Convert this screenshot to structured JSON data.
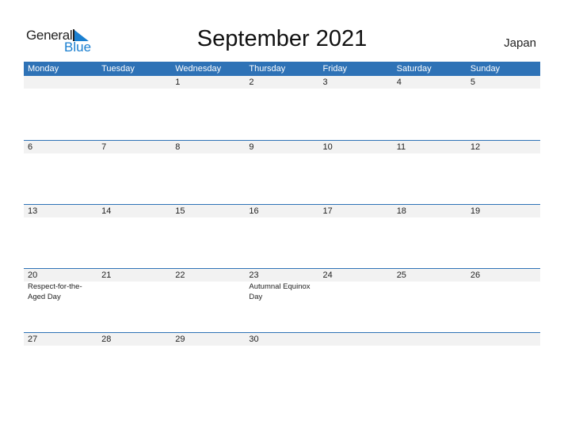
{
  "brand": {
    "word1": "General",
    "word2": "Blue",
    "color": "#1a7fd0"
  },
  "title": "September 2021",
  "country": "Japan",
  "header_color": "#2e72b6",
  "weekdays": [
    "Monday",
    "Tuesday",
    "Wednesday",
    "Thursday",
    "Friday",
    "Saturday",
    "Sunday"
  ],
  "weeks": [
    {
      "days": [
        {
          "d": "",
          "h": ""
        },
        {
          "d": "",
          "h": ""
        },
        {
          "d": "1",
          "h": ""
        },
        {
          "d": "2",
          "h": ""
        },
        {
          "d": "3",
          "h": ""
        },
        {
          "d": "4",
          "h": ""
        },
        {
          "d": "5",
          "h": ""
        }
      ]
    },
    {
      "days": [
        {
          "d": "6",
          "h": ""
        },
        {
          "d": "7",
          "h": ""
        },
        {
          "d": "8",
          "h": ""
        },
        {
          "d": "9",
          "h": ""
        },
        {
          "d": "10",
          "h": ""
        },
        {
          "d": "11",
          "h": ""
        },
        {
          "d": "12",
          "h": ""
        }
      ]
    },
    {
      "days": [
        {
          "d": "13",
          "h": ""
        },
        {
          "d": "14",
          "h": ""
        },
        {
          "d": "15",
          "h": ""
        },
        {
          "d": "16",
          "h": ""
        },
        {
          "d": "17",
          "h": ""
        },
        {
          "d": "18",
          "h": ""
        },
        {
          "d": "19",
          "h": ""
        }
      ]
    },
    {
      "days": [
        {
          "d": "20",
          "h": "Respect-for-the-Aged Day"
        },
        {
          "d": "21",
          "h": ""
        },
        {
          "d": "22",
          "h": ""
        },
        {
          "d": "23",
          "h": "Autumnal Equinox Day"
        },
        {
          "d": "24",
          "h": ""
        },
        {
          "d": "25",
          "h": ""
        },
        {
          "d": "26",
          "h": ""
        }
      ]
    },
    {
      "days": [
        {
          "d": "27",
          "h": ""
        },
        {
          "d": "28",
          "h": ""
        },
        {
          "d": "29",
          "h": ""
        },
        {
          "d": "30",
          "h": ""
        },
        {
          "d": "",
          "h": ""
        },
        {
          "d": "",
          "h": ""
        },
        {
          "d": "",
          "h": ""
        }
      ]
    }
  ]
}
